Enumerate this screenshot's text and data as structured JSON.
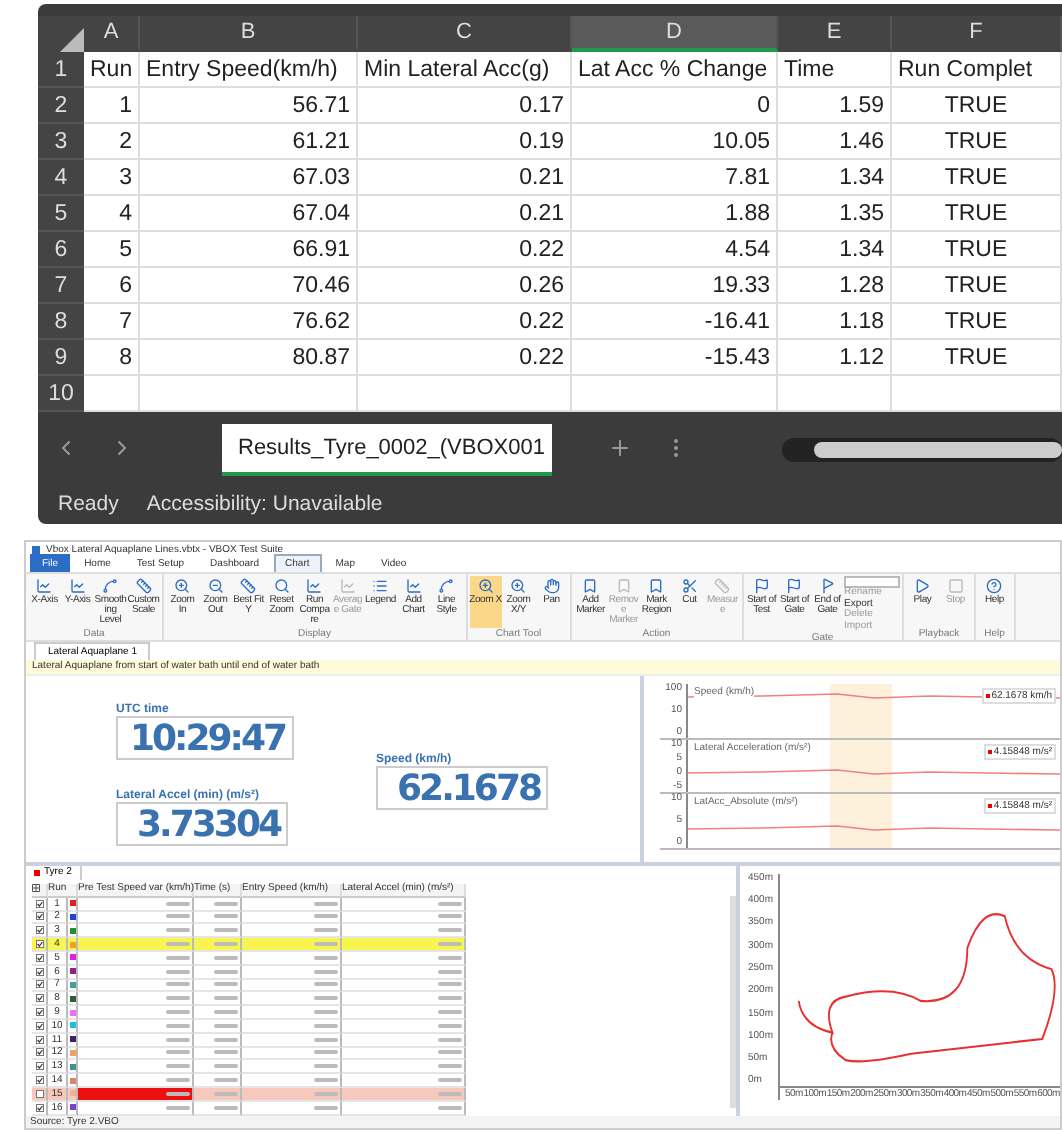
{
  "spreadsheet": {
    "columns": [
      {
        "letter": "A",
        "selected": false
      },
      {
        "letter": "B",
        "selected": false
      },
      {
        "letter": "C",
        "selected": false
      },
      {
        "letter": "D",
        "selected": true
      },
      {
        "letter": "E",
        "selected": false
      },
      {
        "letter": "F",
        "selected": false
      }
    ],
    "rows": [
      {
        "number": "1",
        "kind": "header",
        "cells": [
          "Run",
          "Entry Speed(km/h)",
          "Min Lateral Acc(g)",
          "Lat Acc % Change",
          "Time",
          "Run Complet"
        ]
      },
      {
        "number": "2",
        "kind": "data",
        "cells": [
          "1",
          "56.71",
          "0.17",
          "0",
          "1.59",
          "TRUE"
        ]
      },
      {
        "number": "3",
        "kind": "data",
        "cells": [
          "2",
          "61.21",
          "0.19",
          "10.05",
          "1.46",
          "TRUE"
        ]
      },
      {
        "number": "4",
        "kind": "data",
        "cells": [
          "3",
          "67.03",
          "0.21",
          "7.81",
          "1.34",
          "TRUE"
        ]
      },
      {
        "number": "5",
        "kind": "data",
        "cells": [
          "4",
          "67.04",
          "0.21",
          "1.88",
          "1.35",
          "TRUE"
        ]
      },
      {
        "number": "6",
        "kind": "data",
        "cells": [
          "5",
          "66.91",
          "0.22",
          "4.54",
          "1.34",
          "TRUE"
        ]
      },
      {
        "number": "7",
        "kind": "data",
        "cells": [
          "6",
          "70.46",
          "0.26",
          "19.33",
          "1.28",
          "TRUE"
        ]
      },
      {
        "number": "8",
        "kind": "data",
        "cells": [
          "7",
          "76.62",
          "0.22",
          "-16.41",
          "1.18",
          "TRUE"
        ]
      },
      {
        "number": "9",
        "kind": "data",
        "cells": [
          "8",
          "80.87",
          "0.22",
          "-15.43",
          "1.12",
          "TRUE"
        ]
      },
      {
        "number": "10",
        "kind": "data",
        "cells": [
          "",
          "",
          "",
          "",
          "",
          ""
        ]
      }
    ],
    "sheet_tab": {
      "label": "Results_Tyre_0002_(VBOX001",
      "selected": true
    },
    "status": "Ready",
    "accessibility": "Accessibility: Unavailable"
  },
  "app": {
    "title": "Vbox Lateral Aquaplane Lines.vbtx - VBOX Test Suite",
    "menu_tabs": [
      {
        "label": "File",
        "selected": false
      },
      {
        "label": "Home",
        "selected": false
      },
      {
        "label": "Test Setup",
        "selected": false
      },
      {
        "label": "Dashboard",
        "selected": false
      },
      {
        "label": "Chart",
        "selected": true
      },
      {
        "label": "Map",
        "selected": false
      },
      {
        "label": "Video",
        "selected": false
      }
    ],
    "ribbon": [
      {
        "label": "Data",
        "buttons": [
          {
            "label": "X-Axis",
            "disabled": false,
            "selected": false
          },
          {
            "label": "Y-Axis",
            "disabled": false,
            "selected": false
          },
          {
            "label": "Smoothing Level",
            "disabled": false,
            "selected": false
          },
          {
            "label": "Custom Scale",
            "disabled": false,
            "selected": false
          }
        ]
      },
      {
        "label": "Display",
        "buttons": [
          {
            "label": "Zoom In",
            "disabled": false,
            "selected": false
          },
          {
            "label": "Zoom Out",
            "disabled": false,
            "selected": false
          },
          {
            "label": "Best Fit Y",
            "disabled": false,
            "selected": false
          },
          {
            "label": "Reset Zoom",
            "disabled": false,
            "selected": false
          },
          {
            "label": "Run Compare",
            "disabled": false,
            "selected": false
          },
          {
            "label": "Average Gate",
            "disabled": true,
            "selected": false
          },
          {
            "label": "Legend",
            "disabled": false,
            "selected": false
          },
          {
            "label": "Add Chart",
            "disabled": false,
            "selected": false
          },
          {
            "label": "Line Style",
            "disabled": false,
            "selected": false
          }
        ]
      },
      {
        "label": "Chart Tool",
        "buttons": [
          {
            "label": "Zoom X",
            "disabled": false,
            "selected": true
          },
          {
            "label": "Zoom X/Y",
            "disabled": false,
            "selected": false
          },
          {
            "label": "Pan",
            "disabled": false,
            "selected": false
          }
        ]
      },
      {
        "label": "Action",
        "buttons": [
          {
            "label": "Add Marker",
            "disabled": false,
            "selected": false
          },
          {
            "label": "Remove Marker",
            "disabled": true,
            "selected": false
          },
          {
            "label": "Mark Region",
            "disabled": false,
            "selected": false
          },
          {
            "label": "Cut",
            "disabled": false,
            "selected": false
          },
          {
            "label": "Measure",
            "disabled": true,
            "selected": false
          }
        ]
      },
      {
        "label": "Gate",
        "buttons": [
          {
            "label": "Start of Test",
            "disabled": false,
            "selected": false
          },
          {
            "label": "Start of Gate",
            "disabled": false,
            "selected": false
          },
          {
            "label": "End of Gate",
            "disabled": false,
            "selected": false
          }
        ]
      },
      {
        "label": "Playback",
        "buttons": [
          {
            "label": "Play",
            "disabled": false,
            "selected": false
          },
          {
            "label": "Stop",
            "disabled": true,
            "selected": false
          }
        ]
      },
      {
        "label": "Help",
        "buttons": [
          {
            "label": "Help",
            "disabled": false,
            "selected": false
          }
        ]
      }
    ],
    "gate_actions": [
      {
        "label": "Rename",
        "disabled": true
      },
      {
        "label": "Export",
        "disabled": false
      },
      {
        "label": "Delete",
        "disabled": true
      },
      {
        "label": "Import",
        "disabled": true
      }
    ],
    "doc_tab": "Lateral Aquaplane 1",
    "info": "Lateral Aquaplane from start of water bath until end of water bath",
    "gauges": [
      {
        "label": "UTC time",
        "value": "10:29:47"
      },
      {
        "label": "Speed (km/h)",
        "value": "62.1678"
      },
      {
        "label": "Lateral Accel (min) (m/s²)",
        "value": "3.73304"
      }
    ],
    "graphs": [
      {
        "title": "Speed (km/h)",
        "reading": "62.1678 km/h",
        "ticks": [
          "100",
          "10",
          "0"
        ]
      },
      {
        "title": "Lateral Acceleration (m/s²)",
        "reading": "4.15848 m/s²",
        "ticks": [
          "10",
          "5",
          "0",
          "-5"
        ]
      },
      {
        "title": "LatAcc_Absolute (m/s²)",
        "reading": "4.15848 m/s²",
        "ticks": [
          "10",
          "5",
          "0"
        ]
      }
    ],
    "table": {
      "tab": "Tyre 2",
      "columns": [
        "Run",
        "Pre Test Speed var (km/h)",
        "Time (s)",
        "Entry Speed (km/h)",
        "Lateral Accel (min) (m/s²)"
      ],
      "rows": [
        {
          "run": "1",
          "color": "#e02020",
          "checked": true,
          "selected": false
        },
        {
          "run": "2",
          "color": "#2040e0",
          "checked": true,
          "selected": false
        },
        {
          "run": "3",
          "color": "#209030",
          "checked": true,
          "selected": false
        },
        {
          "run": "4",
          "color": "#f0a020",
          "checked": true,
          "selected": true
        },
        {
          "run": "5",
          "color": "#e020e0",
          "checked": true,
          "selected": false
        },
        {
          "run": "6",
          "color": "#902090",
          "checked": true,
          "selected": false
        },
        {
          "run": "7",
          "color": "#40a0a0",
          "checked": true,
          "selected": false
        },
        {
          "run": "8",
          "color": "#306030",
          "checked": true,
          "selected": false
        },
        {
          "run": "9",
          "color": "#f070f0",
          "checked": true,
          "selected": false
        },
        {
          "run": "10",
          "color": "#20c0d0",
          "checked": true,
          "selected": false
        },
        {
          "run": "11",
          "color": "#402060",
          "checked": true,
          "selected": false
        },
        {
          "run": "12",
          "color": "#f0a060",
          "checked": true,
          "selected": false
        },
        {
          "run": "13",
          "color": "#409090",
          "checked": true,
          "selected": false
        },
        {
          "run": "14",
          "color": "#e08070",
          "checked": true,
          "selected": false
        },
        {
          "run": "15",
          "color": "#f0b0a0",
          "checked": false,
          "selected": false
        },
        {
          "run": "16",
          "color": "#8040c0",
          "checked": true,
          "selected": false
        }
      ]
    },
    "map": {
      "y_ticks": [
        "450m",
        "400m",
        "350m",
        "300m",
        "250m",
        "200m",
        "150m",
        "100m",
        "50m",
        "0m"
      ],
      "x_ticks": [
        "50m",
        "100m",
        "150m",
        "200m",
        "250m",
        "300m",
        "350m",
        "400m",
        "450m",
        "500m",
        "550m",
        "600m"
      ]
    },
    "status": "Source: Tyre 2.VBO"
  }
}
